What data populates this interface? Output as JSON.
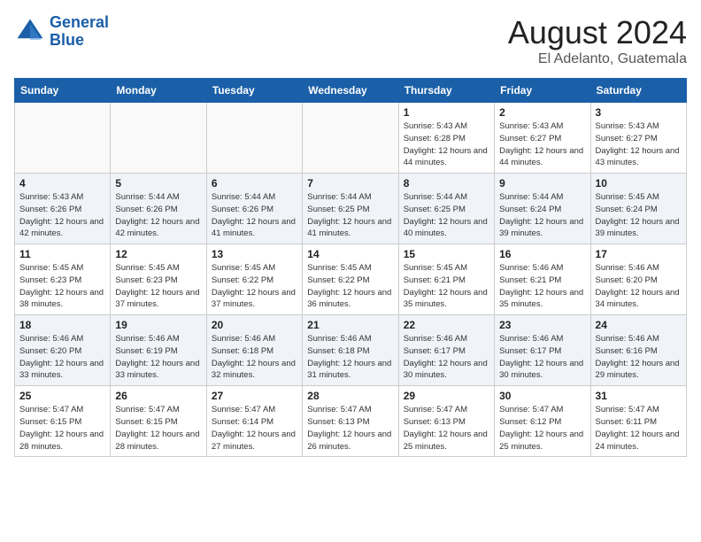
{
  "header": {
    "logo_line1": "General",
    "logo_line2": "Blue",
    "month_year": "August 2024",
    "location": "El Adelanto, Guatemala"
  },
  "weekdays": [
    "Sunday",
    "Monday",
    "Tuesday",
    "Wednesday",
    "Thursday",
    "Friday",
    "Saturday"
  ],
  "weeks": [
    [
      {
        "day": "",
        "sunrise": "",
        "sunset": "",
        "daylight": ""
      },
      {
        "day": "",
        "sunrise": "",
        "sunset": "",
        "daylight": ""
      },
      {
        "day": "",
        "sunrise": "",
        "sunset": "",
        "daylight": ""
      },
      {
        "day": "",
        "sunrise": "",
        "sunset": "",
        "daylight": ""
      },
      {
        "day": "1",
        "sunrise": "Sunrise: 5:43 AM",
        "sunset": "Sunset: 6:28 PM",
        "daylight": "Daylight: 12 hours and 44 minutes."
      },
      {
        "day": "2",
        "sunrise": "Sunrise: 5:43 AM",
        "sunset": "Sunset: 6:27 PM",
        "daylight": "Daylight: 12 hours and 44 minutes."
      },
      {
        "day": "3",
        "sunrise": "Sunrise: 5:43 AM",
        "sunset": "Sunset: 6:27 PM",
        "daylight": "Daylight: 12 hours and 43 minutes."
      }
    ],
    [
      {
        "day": "4",
        "sunrise": "Sunrise: 5:43 AM",
        "sunset": "Sunset: 6:26 PM",
        "daylight": "Daylight: 12 hours and 42 minutes."
      },
      {
        "day": "5",
        "sunrise": "Sunrise: 5:44 AM",
        "sunset": "Sunset: 6:26 PM",
        "daylight": "Daylight: 12 hours and 42 minutes."
      },
      {
        "day": "6",
        "sunrise": "Sunrise: 5:44 AM",
        "sunset": "Sunset: 6:26 PM",
        "daylight": "Daylight: 12 hours and 41 minutes."
      },
      {
        "day": "7",
        "sunrise": "Sunrise: 5:44 AM",
        "sunset": "Sunset: 6:25 PM",
        "daylight": "Daylight: 12 hours and 41 minutes."
      },
      {
        "day": "8",
        "sunrise": "Sunrise: 5:44 AM",
        "sunset": "Sunset: 6:25 PM",
        "daylight": "Daylight: 12 hours and 40 minutes."
      },
      {
        "day": "9",
        "sunrise": "Sunrise: 5:44 AM",
        "sunset": "Sunset: 6:24 PM",
        "daylight": "Daylight: 12 hours and 39 minutes."
      },
      {
        "day": "10",
        "sunrise": "Sunrise: 5:45 AM",
        "sunset": "Sunset: 6:24 PM",
        "daylight": "Daylight: 12 hours and 39 minutes."
      }
    ],
    [
      {
        "day": "11",
        "sunrise": "Sunrise: 5:45 AM",
        "sunset": "Sunset: 6:23 PM",
        "daylight": "Daylight: 12 hours and 38 minutes."
      },
      {
        "day": "12",
        "sunrise": "Sunrise: 5:45 AM",
        "sunset": "Sunset: 6:23 PM",
        "daylight": "Daylight: 12 hours and 37 minutes."
      },
      {
        "day": "13",
        "sunrise": "Sunrise: 5:45 AM",
        "sunset": "Sunset: 6:22 PM",
        "daylight": "Daylight: 12 hours and 37 minutes."
      },
      {
        "day": "14",
        "sunrise": "Sunrise: 5:45 AM",
        "sunset": "Sunset: 6:22 PM",
        "daylight": "Daylight: 12 hours and 36 minutes."
      },
      {
        "day": "15",
        "sunrise": "Sunrise: 5:45 AM",
        "sunset": "Sunset: 6:21 PM",
        "daylight": "Daylight: 12 hours and 35 minutes."
      },
      {
        "day": "16",
        "sunrise": "Sunrise: 5:46 AM",
        "sunset": "Sunset: 6:21 PM",
        "daylight": "Daylight: 12 hours and 35 minutes."
      },
      {
        "day": "17",
        "sunrise": "Sunrise: 5:46 AM",
        "sunset": "Sunset: 6:20 PM",
        "daylight": "Daylight: 12 hours and 34 minutes."
      }
    ],
    [
      {
        "day": "18",
        "sunrise": "Sunrise: 5:46 AM",
        "sunset": "Sunset: 6:20 PM",
        "daylight": "Daylight: 12 hours and 33 minutes."
      },
      {
        "day": "19",
        "sunrise": "Sunrise: 5:46 AM",
        "sunset": "Sunset: 6:19 PM",
        "daylight": "Daylight: 12 hours and 33 minutes."
      },
      {
        "day": "20",
        "sunrise": "Sunrise: 5:46 AM",
        "sunset": "Sunset: 6:18 PM",
        "daylight": "Daylight: 12 hours and 32 minutes."
      },
      {
        "day": "21",
        "sunrise": "Sunrise: 5:46 AM",
        "sunset": "Sunset: 6:18 PM",
        "daylight": "Daylight: 12 hours and 31 minutes."
      },
      {
        "day": "22",
        "sunrise": "Sunrise: 5:46 AM",
        "sunset": "Sunset: 6:17 PM",
        "daylight": "Daylight: 12 hours and 30 minutes."
      },
      {
        "day": "23",
        "sunrise": "Sunrise: 5:46 AM",
        "sunset": "Sunset: 6:17 PM",
        "daylight": "Daylight: 12 hours and 30 minutes."
      },
      {
        "day": "24",
        "sunrise": "Sunrise: 5:46 AM",
        "sunset": "Sunset: 6:16 PM",
        "daylight": "Daylight: 12 hours and 29 minutes."
      }
    ],
    [
      {
        "day": "25",
        "sunrise": "Sunrise: 5:47 AM",
        "sunset": "Sunset: 6:15 PM",
        "daylight": "Daylight: 12 hours and 28 minutes."
      },
      {
        "day": "26",
        "sunrise": "Sunrise: 5:47 AM",
        "sunset": "Sunset: 6:15 PM",
        "daylight": "Daylight: 12 hours and 28 minutes."
      },
      {
        "day": "27",
        "sunrise": "Sunrise: 5:47 AM",
        "sunset": "Sunset: 6:14 PM",
        "daylight": "Daylight: 12 hours and 27 minutes."
      },
      {
        "day": "28",
        "sunrise": "Sunrise: 5:47 AM",
        "sunset": "Sunset: 6:13 PM",
        "daylight": "Daylight: 12 hours and 26 minutes."
      },
      {
        "day": "29",
        "sunrise": "Sunrise: 5:47 AM",
        "sunset": "Sunset: 6:13 PM",
        "daylight": "Daylight: 12 hours and 25 minutes."
      },
      {
        "day": "30",
        "sunrise": "Sunrise: 5:47 AM",
        "sunset": "Sunset: 6:12 PM",
        "daylight": "Daylight: 12 hours and 25 minutes."
      },
      {
        "day": "31",
        "sunrise": "Sunrise: 5:47 AM",
        "sunset": "Sunset: 6:11 PM",
        "daylight": "Daylight: 12 hours and 24 minutes."
      }
    ]
  ]
}
